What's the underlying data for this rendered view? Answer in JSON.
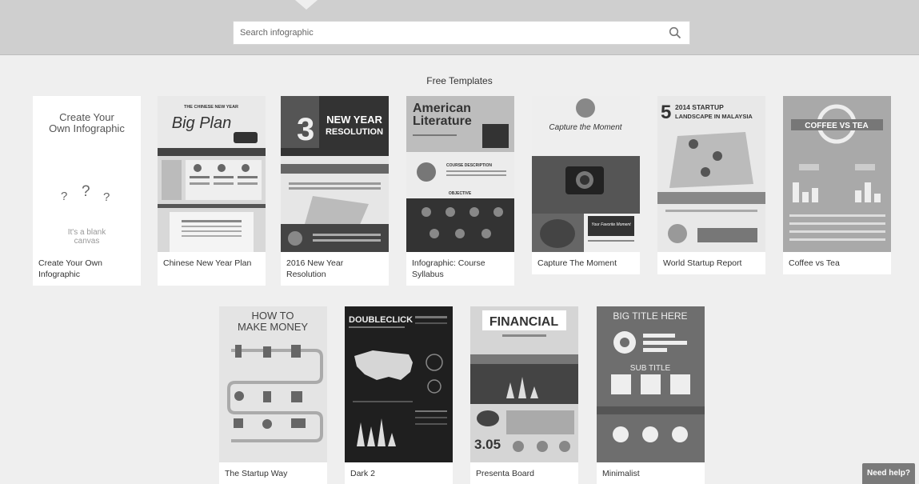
{
  "search": {
    "placeholder": "Search infographic"
  },
  "section_title": "Free Templates",
  "blank_card": {
    "title": "Create Your Own Infographic",
    "subtitle": "It's a blank canvas"
  },
  "templates_row1": [
    {
      "label": "Create Your Own Infographic"
    },
    {
      "label": "Chinese New Year Plan"
    },
    {
      "label": "2016 New Year Resolution"
    },
    {
      "label": "Infographic: Course Syllabus"
    },
    {
      "label": "Capture The Moment"
    },
    {
      "label": "World Startup Report"
    },
    {
      "label": "Coffee vs Tea"
    }
  ],
  "templates_row2": [
    {
      "label": "The Startup Way"
    },
    {
      "label": "Dark 2"
    },
    {
      "label": "Presenta Board"
    },
    {
      "label": "Minimalist"
    }
  ],
  "thumb_text": {
    "cny_header": "THE CHINESE NEW YEAR",
    "cny_title": "Big Plan",
    "ny_number": "3",
    "ny_title1": "NEW YEAR",
    "ny_title2": "RESOLUTION",
    "al_title1": "American",
    "al_title2": "Literature",
    "al_course": "COURSE DESCRIPTION",
    "al_objective": "OBJECTIVE",
    "cm_title": "Capture the Moment",
    "cm_sub": "Your Favorite Moment",
    "ws_num": "5",
    "ws_title1": "2014 STARTUP",
    "ws_title2": "LANDSCAPE IN MALAYSIA",
    "ct_title": "COFFEE VS TEA",
    "su_title1": "HOW TO",
    "su_title2": "MAKE MONEY",
    "dc_title": "DOUBLECLICK",
    "fi_title": "FINANCIAL",
    "fi_number": "3.05",
    "mi_title": "BIG TITLE HERE",
    "mi_sub": "SUB TITLE"
  },
  "help_button": "Need help?"
}
